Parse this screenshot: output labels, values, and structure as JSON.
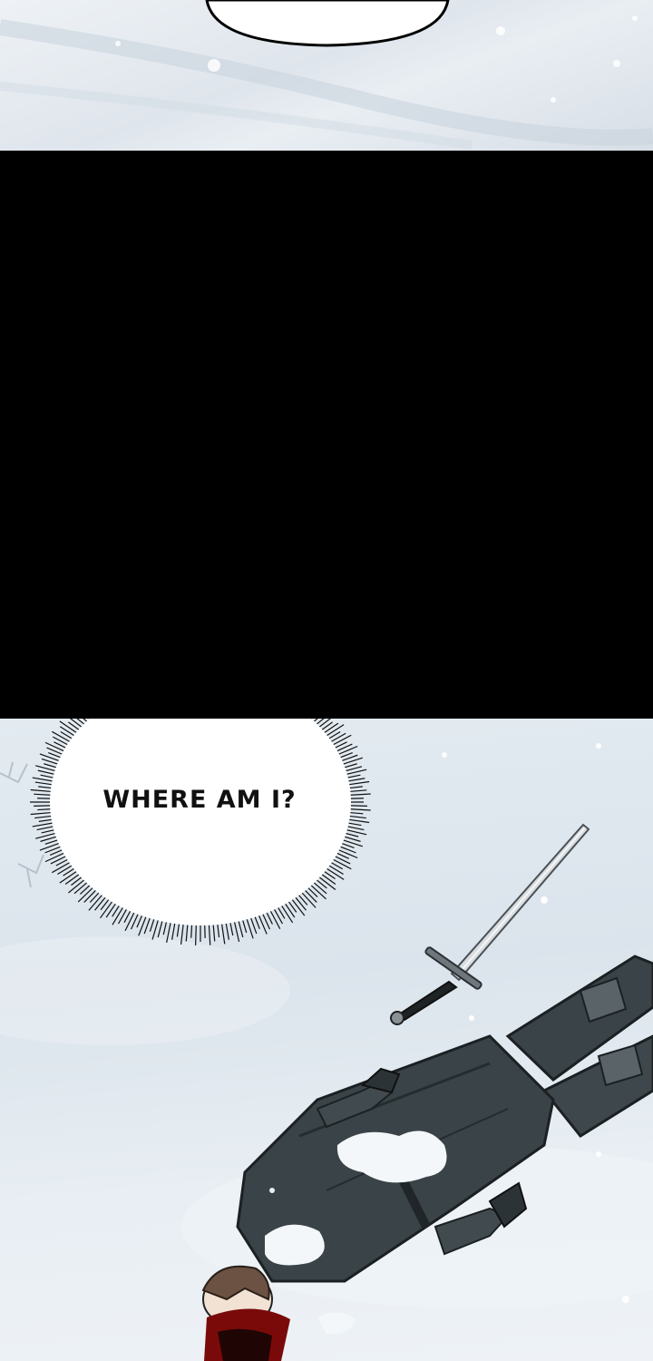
{
  "panels": [
    {
      "id": "top",
      "scene": "snow-sky"
    },
    {
      "id": "middle",
      "scene": "black-void"
    },
    {
      "id": "bottom",
      "scene": "knight-lying-in-snow"
    }
  ],
  "speech_bubble": {
    "text": "WHERE AM I?",
    "style": "spiky-thought"
  },
  "colors": {
    "snow": "#e3ebf1",
    "void": "#000000",
    "armor": "#3a4347",
    "blood": "#7a0a0a"
  }
}
